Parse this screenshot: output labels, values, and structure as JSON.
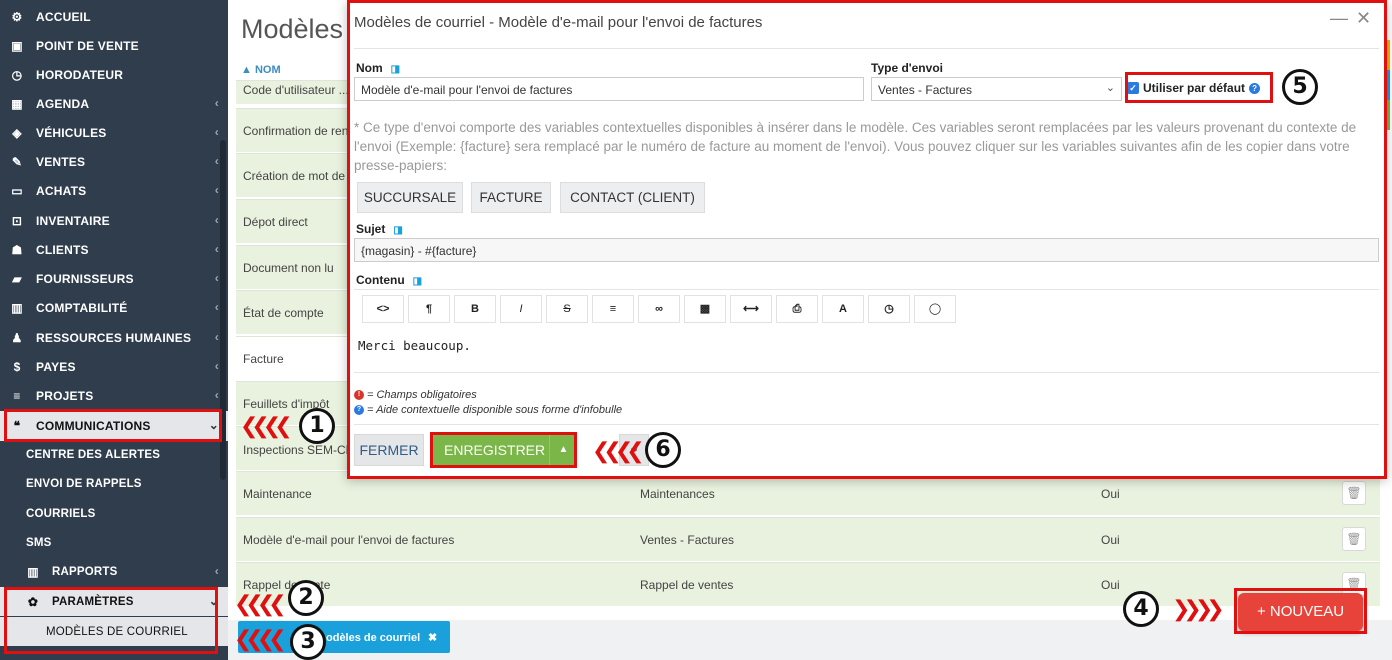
{
  "sidebar": {
    "items": [
      {
        "label": "ACCUEIL",
        "icon": "dashboard-icon",
        "glyph": "⚙"
      },
      {
        "label": "POINT DE VENTE",
        "icon": "cash-register-icon",
        "glyph": "▣"
      },
      {
        "label": "HORODATEUR",
        "icon": "clock-icon",
        "glyph": "◷"
      },
      {
        "label": "AGENDA",
        "icon": "calendar-icon",
        "glyph": "▦"
      },
      {
        "label": "VÉHICULES",
        "icon": "car-icon",
        "glyph": "◈"
      },
      {
        "label": "VENTES",
        "icon": "edit-icon",
        "glyph": "✎"
      },
      {
        "label": "ACHATS",
        "icon": "credit-card-icon",
        "glyph": "▭"
      },
      {
        "label": "INVENTAIRE",
        "icon": "cart-icon",
        "glyph": "⊡"
      },
      {
        "label": "CLIENTS",
        "icon": "users-icon",
        "glyph": "☗"
      },
      {
        "label": "FOURNISSEURS",
        "icon": "truck-icon",
        "glyph": "▰"
      },
      {
        "label": "COMPTABILITÉ",
        "icon": "bar-chart-icon",
        "glyph": "▥"
      },
      {
        "label": "RESSOURCES HUMAINES",
        "icon": "user-icon",
        "glyph": "♟"
      },
      {
        "label": "PAYES",
        "icon": "dollar-icon",
        "glyph": "$"
      },
      {
        "label": "PROJETS",
        "icon": "list-icon",
        "glyph": "≡"
      },
      {
        "label": "COMMUNICATIONS",
        "icon": "comments-icon",
        "glyph": "❝"
      }
    ],
    "communications_sub": [
      "CENTRE DES ALERTES",
      "ENVOI DE RAPPELS",
      "COURRIELS",
      "SMS"
    ],
    "rapports": {
      "label": "RAPPORTS",
      "icon": "bar-chart-icon",
      "glyph": "▥"
    },
    "parametres": {
      "label": "PARAMÈTRES",
      "icon": "gear-icon",
      "glyph": "✿"
    },
    "modeles_label": "MODÈLES DE COURRIEL"
  },
  "page": {
    "title": "Modèles",
    "col_header": "▲ NOM",
    "rows_partial": [
      "Code d'utilisateur ...",
      "Confirmation de ren",
      "Création de mot de",
      "Dépot direct",
      "Document non lu",
      "État de compte",
      "Facture",
      "Feuillets d'impôt",
      "Inspections SEM-Cl"
    ],
    "rows_full": [
      {
        "name": "Maintenance",
        "type": "Maintenances",
        "default": "Oui"
      },
      {
        "name": "Modèle d'e-mail pour l'envoi de factures",
        "type": "Ventes - Factures",
        "default": "Oui"
      },
      {
        "name": "Rappel de vente",
        "type": "Rappel de ventes",
        "default": "Oui"
      }
    ],
    "trash_icon": "trash-icon",
    "new_button": "+ NOUVEAU",
    "bottom_tab": {
      "label": "odèles de courriel",
      "close": "✖"
    }
  },
  "modal": {
    "title": "Modèles de courriel - Modèle d'e-mail pour l'envoi de factures",
    "minimize": "—",
    "close": "✕",
    "nom_label": "Nom",
    "nom_value": "Modèle d'e-mail pour l'envoi de factures",
    "type_label": "Type d'envoi",
    "type_value": "Ventes - Factures",
    "default_label": "Utiliser par défaut",
    "note": "* Ce type d'envoi comporte des variables contextuelles disponibles à insérer dans le modèle. Ces variables seront remplacées par les valeurs provenant du contexte de l'envoi (Exemple: {facture} sera remplacé par le numéro de facture au moment de l'envoi). Vous pouvez cliquer sur les variables suivantes afin de les copier dans votre presse-papiers:",
    "variables": [
      "SUCCURSALE",
      "FACTURE",
      "CONTACT (CLIENT)"
    ],
    "sujet_label": "Sujet",
    "sujet_value": "{magasin} - #{facture}",
    "contenu_label": "Contenu",
    "toolbar": [
      {
        "name": "code-view-icon",
        "glyph": "<>"
      },
      {
        "name": "paragraph-icon",
        "glyph": "¶"
      },
      {
        "name": "bold-icon",
        "glyph": "B"
      },
      {
        "name": "italic-icon",
        "glyph": "I"
      },
      {
        "name": "strikethrough-icon",
        "glyph": "S"
      },
      {
        "name": "list-icon",
        "glyph": "≡"
      },
      {
        "name": "link-icon",
        "glyph": "∞"
      },
      {
        "name": "image-icon",
        "glyph": "▩"
      },
      {
        "name": "horizontal-rule-icon",
        "glyph": "⟷"
      },
      {
        "name": "print-icon",
        "glyph": "⎙"
      },
      {
        "name": "font-icon",
        "glyph": "A"
      },
      {
        "name": "clock-icon",
        "glyph": "◷"
      },
      {
        "name": "comment-icon",
        "glyph": "◯"
      }
    ],
    "content_text": "Merci beaucoup.",
    "legend_required": "= Champs obligatoires",
    "legend_help": "= Aide contextuelle disponible sous forme d'infobulle",
    "btn_fermer": "FERMER",
    "btn_enregistrer": "ENREGISTRER",
    "save_arrow": "▲",
    "link_glyph": "⚭"
  },
  "annotations": [
    "1",
    "2",
    "3",
    "4",
    "5",
    "6"
  ],
  "colors": {
    "sidebar": "#2f3d4d",
    "accent": "#1aa0db",
    "save": "#7ab648",
    "new": "#e8433a",
    "annotation": "#e01010"
  }
}
